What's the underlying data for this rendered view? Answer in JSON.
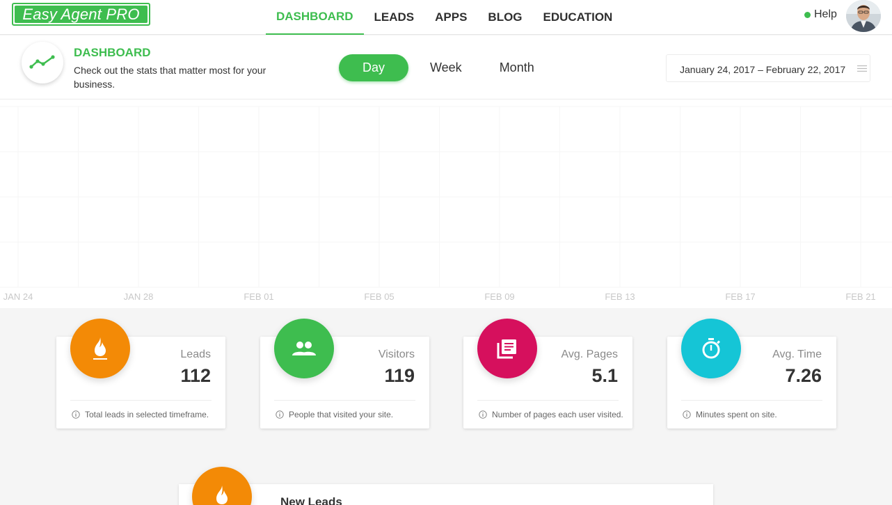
{
  "nav": {
    "logo_text": "Easy Agent PRO",
    "links": [
      "DASHBOARD",
      "LEADS",
      "APPS",
      "BLOG",
      "EDUCATION"
    ],
    "help": "Help",
    "colors": {
      "accent": "#3ebd4f"
    }
  },
  "header": {
    "title": "DASHBOARD",
    "subtitle": "Check out the stats that matter most for your business.",
    "range_tabs": [
      "Day",
      "Week",
      "Month"
    ],
    "active_range": "Day",
    "date_range": "January 24, 2017 – February 22, 2017"
  },
  "chart_data": {
    "type": "line",
    "x_ticks": [
      "JAN 24",
      "JAN 28",
      "FEB 01",
      "FEB 05",
      "FEB 09",
      "FEB 13",
      "FEB 17",
      "FEB 21"
    ],
    "grid": true,
    "series": []
  },
  "cards": [
    {
      "label": "Leads",
      "value": "112",
      "foot": "Total leads in selected timeframe.",
      "icon": "fire-icon",
      "color": "#f38a06"
    },
    {
      "label": "Visitors",
      "value": "119",
      "foot": "People that visited your site.",
      "icon": "people-icon",
      "color": "#3ebd4f"
    },
    {
      "label": "Avg. Pages",
      "value": "5.1",
      "foot": "Number of pages each user visited.",
      "icon": "pages-icon",
      "color": "#d6105d"
    },
    {
      "label": "Avg. Time",
      "value": "7.26",
      "foot": "Minutes spent on site.",
      "icon": "stopwatch-icon",
      "color": "#15c5d6"
    }
  ],
  "new_leads": {
    "title": "New Leads",
    "icon": "fire-icon",
    "color": "#f38a06"
  }
}
